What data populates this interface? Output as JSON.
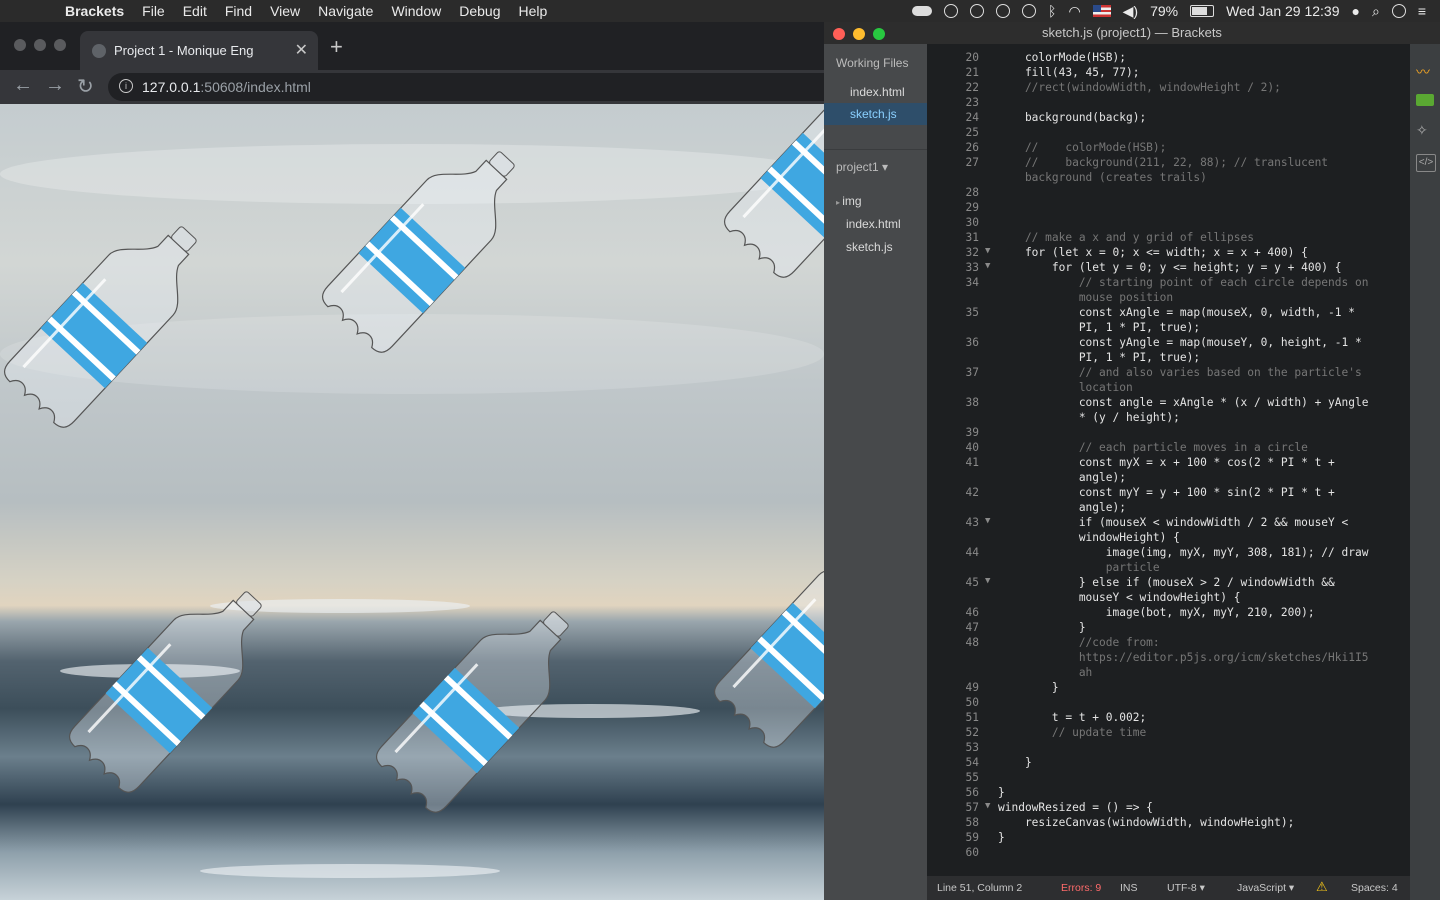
{
  "menubar": {
    "app_name": "Brackets",
    "items": [
      "File",
      "Edit",
      "Find",
      "View",
      "Navigate",
      "Window",
      "Debug",
      "Help"
    ],
    "battery": "79%",
    "datetime": "Wed Jan 29  12:39"
  },
  "browser": {
    "tab_title": "Project 1 - Monique Eng",
    "url_host": "127.0.0.1",
    "url_rest": ":50608/index.html"
  },
  "editor": {
    "window_title": "sketch.js (project1) — Brackets",
    "working_files_label": "Working Files",
    "working_files": [
      "index.html",
      "sketch.js"
    ],
    "project_label": "project1 ▾",
    "tree": [
      "img",
      "index.html",
      "sketch.js"
    ],
    "code_lines": [
      {
        "n": "20",
        "t": "    colorMode(HSB);"
      },
      {
        "n": "21",
        "t": "    fill(43, 45, 77);"
      },
      {
        "n": "22",
        "t": "    //rect(windowWidth, windowHeight / 2);"
      },
      {
        "n": "23",
        "t": ""
      },
      {
        "n": "24",
        "t": "    background(backg);"
      },
      {
        "n": "25",
        "t": ""
      },
      {
        "n": "26",
        "t": "    //    colorMode(HSB);"
      },
      {
        "n": "27",
        "t": "    //    background(211, 22, 88); // translucent"
      },
      {
        "n": "",
        "t": "    background (creates trails)"
      },
      {
        "n": "28",
        "t": ""
      },
      {
        "n": "29",
        "t": ""
      },
      {
        "n": "30",
        "t": ""
      },
      {
        "n": "31",
        "t": "    // make a x and y grid of ellipses"
      },
      {
        "n": "32",
        "t": "    for (let x = 0; x <= width; x = x + 400) {"
      },
      {
        "n": "33",
        "t": "        for (let y = 0; y <= height; y = y + 400) {"
      },
      {
        "n": "34",
        "t": "            // starting point of each circle depends on"
      },
      {
        "n": "",
        "t": "            mouse position"
      },
      {
        "n": "35",
        "t": "            const xAngle = map(mouseX, 0, width, -1 *"
      },
      {
        "n": "",
        "t": "            PI, 1 * PI, true);"
      },
      {
        "n": "36",
        "t": "            const yAngle = map(mouseY, 0, height, -1 *"
      },
      {
        "n": "",
        "t": "            PI, 1 * PI, true);"
      },
      {
        "n": "37",
        "t": "            // and also varies based on the particle's"
      },
      {
        "n": "",
        "t": "            location"
      },
      {
        "n": "38",
        "t": "            const angle = xAngle * (x / width) + yAngle"
      },
      {
        "n": "",
        "t": "            * (y / height);"
      },
      {
        "n": "39",
        "t": ""
      },
      {
        "n": "40",
        "t": "            // each particle moves in a circle"
      },
      {
        "n": "41",
        "t": "            const myX = x + 100 * cos(2 * PI * t +"
      },
      {
        "n": "",
        "t": "            angle);"
      },
      {
        "n": "42",
        "t": "            const myY = y + 100 * sin(2 * PI * t +"
      },
      {
        "n": "",
        "t": "            angle);"
      },
      {
        "n": "43",
        "t": "            if (mouseX < windowWidth / 2 && mouseY <"
      },
      {
        "n": "",
        "t": "            windowHeight) {"
      },
      {
        "n": "44",
        "t": "                image(img, myX, myY, 308, 181); // draw"
      },
      {
        "n": "",
        "t": "                particle"
      },
      {
        "n": "45",
        "t": "            } else if (mouseX > 2 / windowWidth &&"
      },
      {
        "n": "",
        "t": "            mouseY < windowHeight) {"
      },
      {
        "n": "46",
        "t": "                image(bot, myX, myY, 210, 200);"
      },
      {
        "n": "47",
        "t": "            }"
      },
      {
        "n": "48",
        "t": "            //code from:"
      },
      {
        "n": "",
        "t": "            https://editor.p5js.org/icm/sketches/Hki1I5"
      },
      {
        "n": "",
        "t": "            ah"
      },
      {
        "n": "49",
        "t": "        }"
      },
      {
        "n": "50",
        "t": ""
      },
      {
        "n": "51",
        "t": "        t = t + 0.002;"
      },
      {
        "n": "52",
        "t": "        // update time"
      },
      {
        "n": "53",
        "t": ""
      },
      {
        "n": "54",
        "t": "    }"
      },
      {
        "n": "55",
        "t": ""
      },
      {
        "n": "56",
        "t": "}"
      },
      {
        "n": "57",
        "t": "windowResized = () => {"
      },
      {
        "n": "58",
        "t": "    resizeCanvas(windowWidth, windowHeight);"
      },
      {
        "n": "59",
        "t": "}"
      },
      {
        "n": "60",
        "t": ""
      }
    ],
    "fold_lines": [
      "32",
      "33",
      "43",
      "45",
      "57"
    ],
    "status": {
      "position": "Line 51, Column 2",
      "errors": "Errors: 9",
      "mode": "INS",
      "encoding": "UTF-8 ▾",
      "language": "JavaScript ▾",
      "spaces": "Spaces: 4"
    }
  },
  "colors": {
    "accent": "#3fa7e1",
    "editor_bg": "#1d1f21",
    "sidebar_bg": "#47494b"
  }
}
